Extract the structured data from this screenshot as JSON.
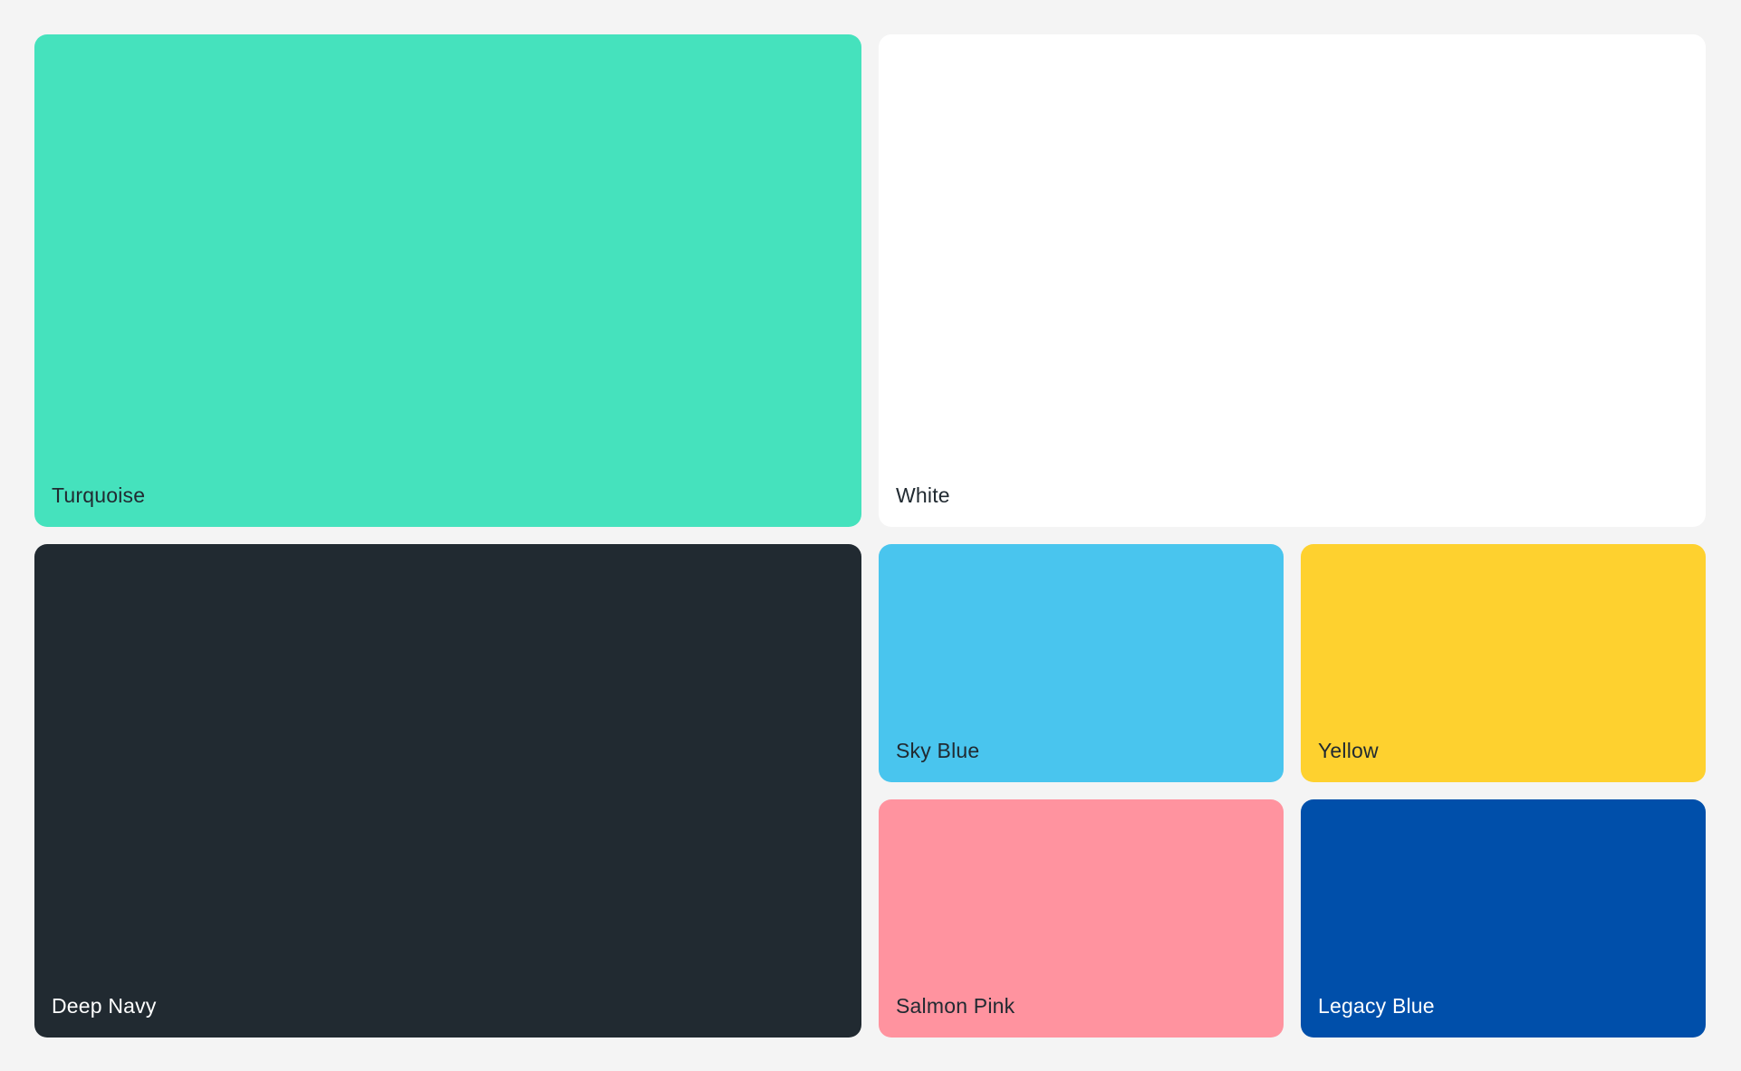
{
  "swatches": [
    {
      "id": "turquoise",
      "label": "Turquoise",
      "color": "#45e2bd",
      "text_color": "#212a31"
    },
    {
      "id": "white",
      "label": "White",
      "color": "#ffffff",
      "text_color": "#212a31"
    },
    {
      "id": "navy",
      "label": "Deep Navy",
      "color": "#212a31",
      "text_color": "#ffffff"
    },
    {
      "id": "sky",
      "label": "Sky Blue",
      "color": "#49c5ee",
      "text_color": "#212a31"
    },
    {
      "id": "yellow",
      "label": "Yellow",
      "color": "#fed12f",
      "text_color": "#212a31"
    },
    {
      "id": "salmon",
      "label": "Salmon Pink",
      "color": "#ff939f",
      "text_color": "#212a31"
    },
    {
      "id": "legacy",
      "label": "Legacy Blue",
      "color": "#004faa",
      "text_color": "#ffffff"
    }
  ]
}
